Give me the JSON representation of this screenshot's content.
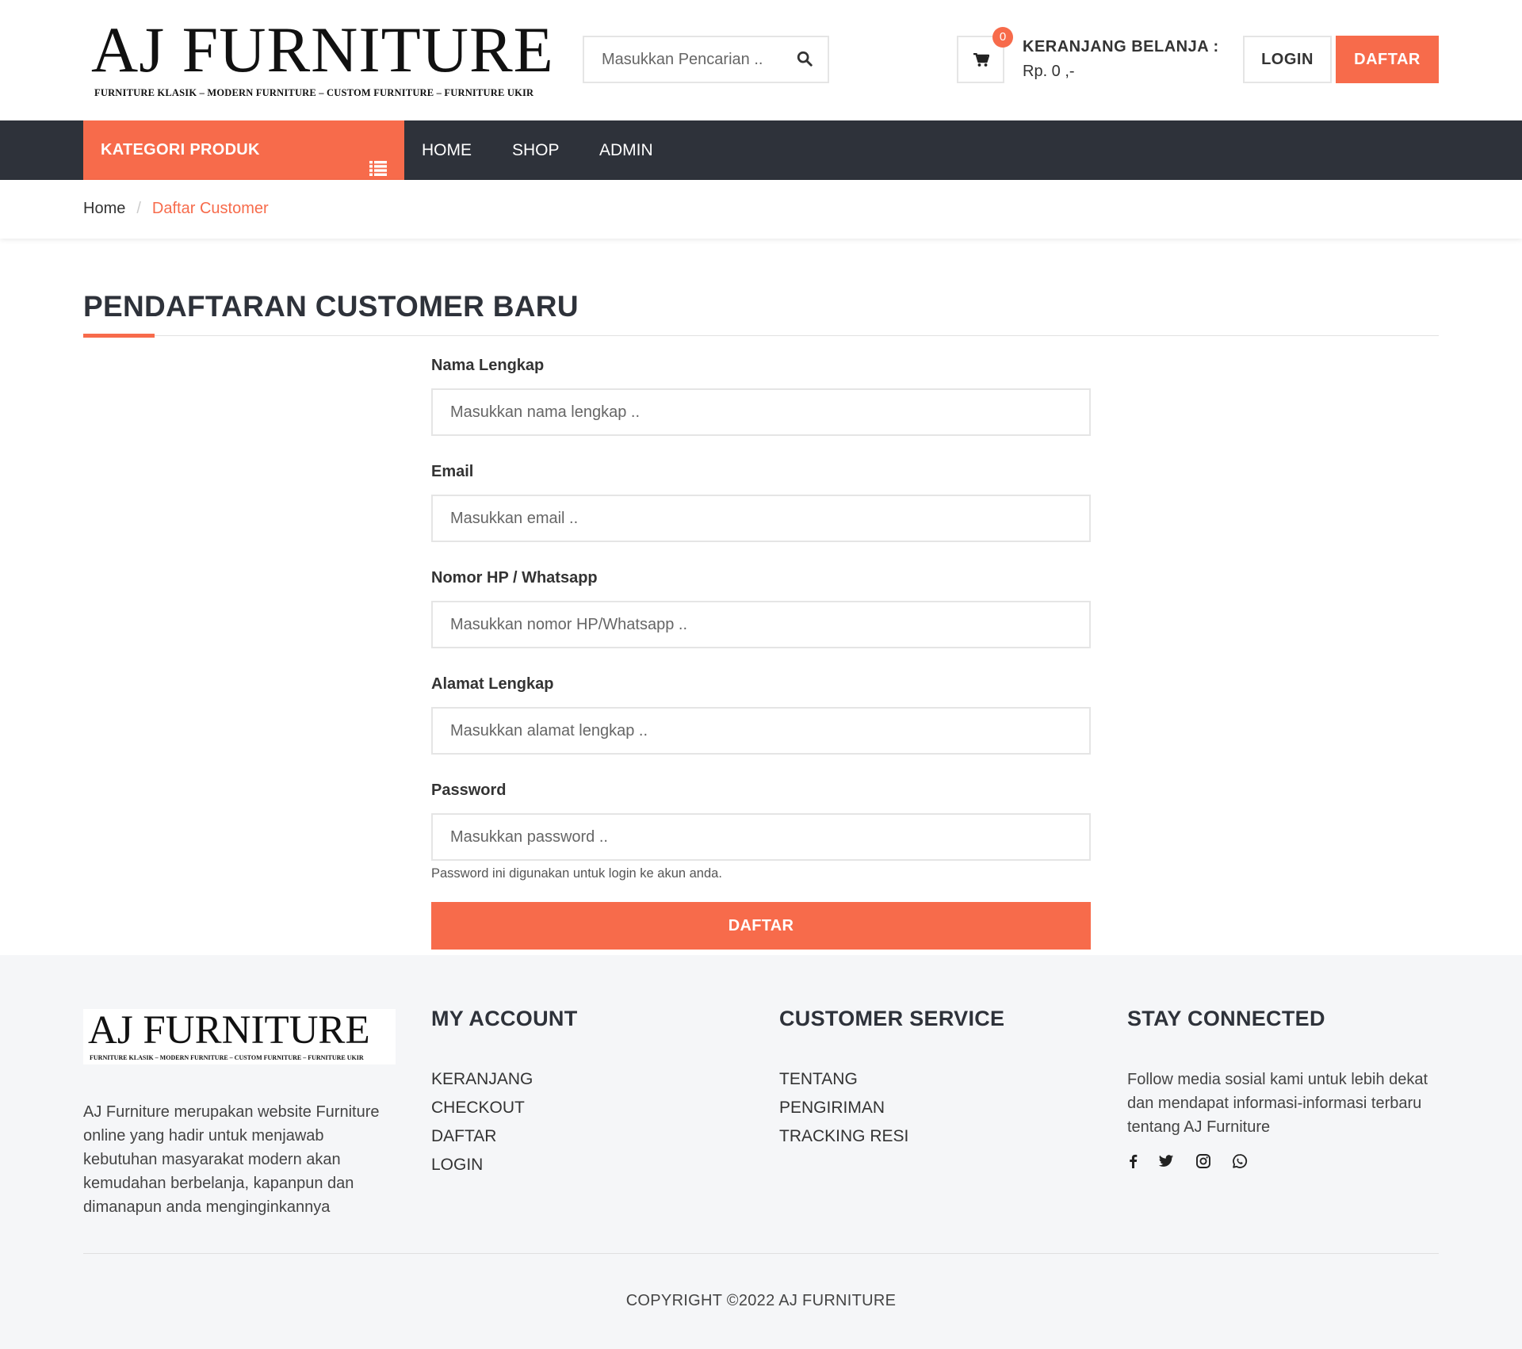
{
  "brand": {
    "name": "AJ FURNITURE",
    "tagline": "FURNITURE KLASIK – MODERN FURNITURE – CUSTOM FURNITURE – FURNITURE UKIR",
    "accent_color": "#f76b4b",
    "nav_bg": "#2e323a"
  },
  "header": {
    "search_placeholder": "Masukkan Pencarian ..",
    "cart_count": "0",
    "cart_title": "KERANJANG BELANJA :",
    "cart_total": "Rp. 0 ,-",
    "login_label": "LOGIN",
    "daftar_label": "DAFTAR"
  },
  "nav": {
    "kategori_label": "KATEGORI PRODUK",
    "items": [
      {
        "label": "HOME"
      },
      {
        "label": "SHOP"
      },
      {
        "label": "ADMIN"
      }
    ]
  },
  "breadcrumb": {
    "home": "Home",
    "separator": "/",
    "current": "Daftar Customer"
  },
  "main": {
    "title": "PENDAFTARAN CUSTOMER BARU",
    "fields": [
      {
        "label": "Nama Lengkap",
        "placeholder": "Masukkan nama lengkap .."
      },
      {
        "label": "Email",
        "placeholder": "Masukkan email .."
      },
      {
        "label": "Nomor HP / Whatsapp",
        "placeholder": "Masukkan nomor HP/Whatsapp .."
      },
      {
        "label": "Alamat Lengkap",
        "placeholder": "Masukkan alamat lengkap .."
      },
      {
        "label": "Password",
        "placeholder": "Masukkan password .."
      }
    ],
    "password_help": "Password ini digunakan untuk login ke akun anda.",
    "submit_label": "DAFTAR"
  },
  "footer": {
    "about": "AJ Furniture merupakan website Furniture online yang hadir untuk menjawab kebutuhan masyarakat modern akan kemudahan berbelanja, kapanpun dan dimanapun anda menginginkannya",
    "my_account": {
      "title": "MY ACCOUNT",
      "links": [
        "KERANJANG",
        "CHECKOUT",
        "DAFTAR",
        "LOGIN"
      ]
    },
    "customer_service": {
      "title": "CUSTOMER SERVICE",
      "links": [
        "TENTANG",
        "PENGIRIMAN",
        "TRACKING RESI"
      ]
    },
    "stay_connected": {
      "title": "STAY CONNECTED",
      "text": "Follow media sosial kami untuk lebih dekat dan mendapat informasi-informasi terbaru tentang AJ Furniture",
      "icons": [
        "facebook-icon",
        "twitter-icon",
        "instagram-icon",
        "whatsapp-icon"
      ]
    },
    "copyright": "COPYRIGHT ©2022 AJ FURNITURE"
  }
}
